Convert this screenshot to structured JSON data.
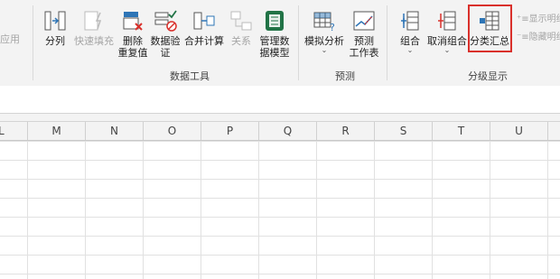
{
  "ribbon": {
    "partial_left_label": "应用",
    "buttons": [
      {
        "id": "split",
        "label": "分列",
        "chevron": ""
      },
      {
        "id": "flashfill",
        "label": "快速填充",
        "chevron": ""
      },
      {
        "id": "removedup",
        "label": "删除\n重复值",
        "chevron": ""
      },
      {
        "id": "validate",
        "label": "数据验\n证",
        "chevron": "⌄"
      },
      {
        "id": "consolidate",
        "label": "合并计算",
        "chevron": ""
      },
      {
        "id": "relations",
        "label": "关系",
        "chevron": ""
      },
      {
        "id": "datamodel",
        "label": "管理数\n据模型",
        "chevron": ""
      },
      {
        "id": "whatif",
        "label": "模拟分析",
        "chevron": "⌄"
      },
      {
        "id": "forecast",
        "label": "预测\n工作表",
        "chevron": ""
      },
      {
        "id": "group",
        "label": "组合",
        "chevron": "⌄"
      },
      {
        "id": "ungroup",
        "label": "取消组合",
        "chevron": "⌄"
      },
      {
        "id": "subtotal",
        "label": "分类汇总",
        "chevron": ""
      }
    ],
    "small_buttons": {
      "show_detail": "显示明细",
      "hide_detail": "隐藏明细"
    },
    "groups": {
      "data_tools": "数据工具",
      "forecast": "预测",
      "outline": "分级显示"
    }
  },
  "columns": [
    "L",
    "M",
    "N",
    "O",
    "P",
    "Q",
    "R",
    "S",
    "T",
    "U"
  ],
  "colors": {
    "accent": "#217346",
    "highlight": "#d9302b",
    "ribbon_bg": "#f3f3f3"
  }
}
